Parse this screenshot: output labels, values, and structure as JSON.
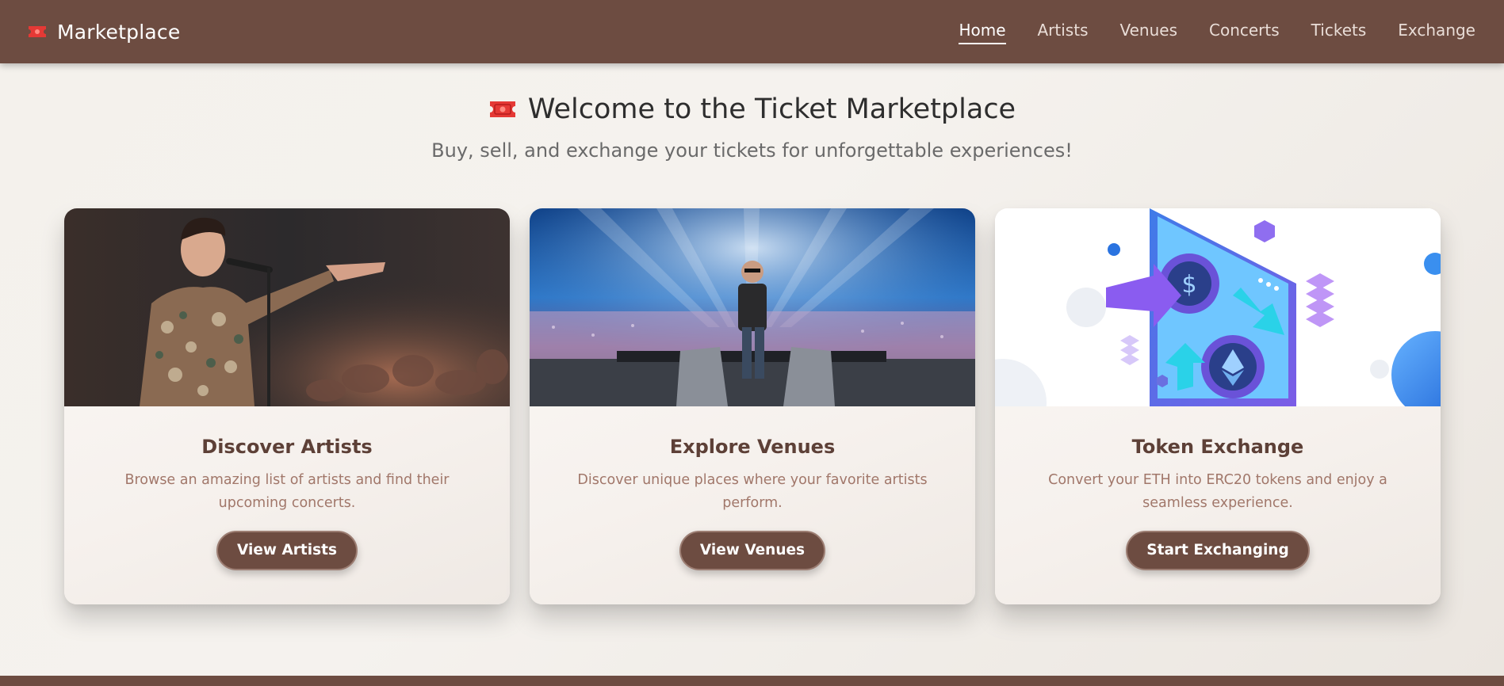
{
  "brand": {
    "name": "Marketplace",
    "icon": "ticket-icon",
    "icon_color": "#e53935"
  },
  "nav": {
    "items": [
      {
        "label": "Home",
        "active": true
      },
      {
        "label": "Artists",
        "active": false
      },
      {
        "label": "Venues",
        "active": false
      },
      {
        "label": "Concerts",
        "active": false
      },
      {
        "label": "Tickets",
        "active": false
      },
      {
        "label": "Exchange",
        "active": false
      }
    ]
  },
  "hero": {
    "title": "Welcome to the Ticket Marketplace",
    "subtitle": "Buy, sell, and exchange your tickets for unforgettable experiences!"
  },
  "cards": [
    {
      "image": "singer-concert-photo",
      "title": "Discover Artists",
      "text": "Browse an amazing list of artists and find their upcoming concerts.",
      "button": "View Artists"
    },
    {
      "image": "stadium-stage-photo",
      "title": "Explore Venues",
      "text": "Discover unique places where your favorite artists perform.",
      "button": "View Venues"
    },
    {
      "image": "crypto-exchange-illustration",
      "title": "Token Exchange",
      "text": "Convert your ETH into ERC20 tokens and enjoy a seamless experience.",
      "button": "Start Exchanging"
    }
  ],
  "colors": {
    "primary": "#6d4c41",
    "card_title": "#5d4037",
    "card_text": "#a1776a",
    "accent_red": "#e53935"
  }
}
